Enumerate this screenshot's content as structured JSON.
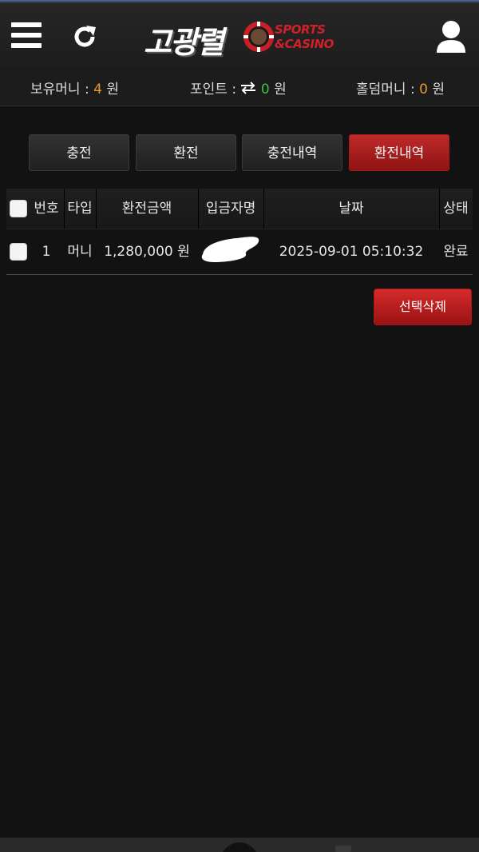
{
  "header": {
    "logo_main": "고광렬",
    "logo_sub_top": "SPORTS",
    "logo_sub_bottom": "&CASINO",
    "menu_icon": "hamburger-menu-icon",
    "refresh_icon": "refresh-icon",
    "user_icon": "user-icon"
  },
  "balance": {
    "money_label": "보유머니 :",
    "money_value": "4",
    "money_unit": "원",
    "point_label": "포인트 :",
    "point_icon": "exchange-arrows-icon",
    "point_value": "0",
    "point_unit": "원",
    "holdem_label": "홀덤머니 :",
    "holdem_value": "0",
    "holdem_unit": "원"
  },
  "tabs": [
    {
      "label": "충전",
      "active": false
    },
    {
      "label": "환전",
      "active": false
    },
    {
      "label": "충전내역",
      "active": false
    },
    {
      "label": "환전내역",
      "active": true
    }
  ],
  "table": {
    "columns": [
      "번호",
      "타입",
      "환전금액",
      "입금자명",
      "날짜",
      "상태"
    ],
    "rows": [
      {
        "no": "1",
        "type": "머니",
        "amount": "1,280,000 원",
        "depositor": "",
        "date": "2025-09-01 05:10:32",
        "status": "완료"
      }
    ]
  },
  "actions": {
    "delete_selected": "선택삭제"
  },
  "colors": {
    "accent_red": "#c02a2a",
    "orange_value": "#e79a2b",
    "green_value": "#37c53a",
    "background": "#121212"
  }
}
